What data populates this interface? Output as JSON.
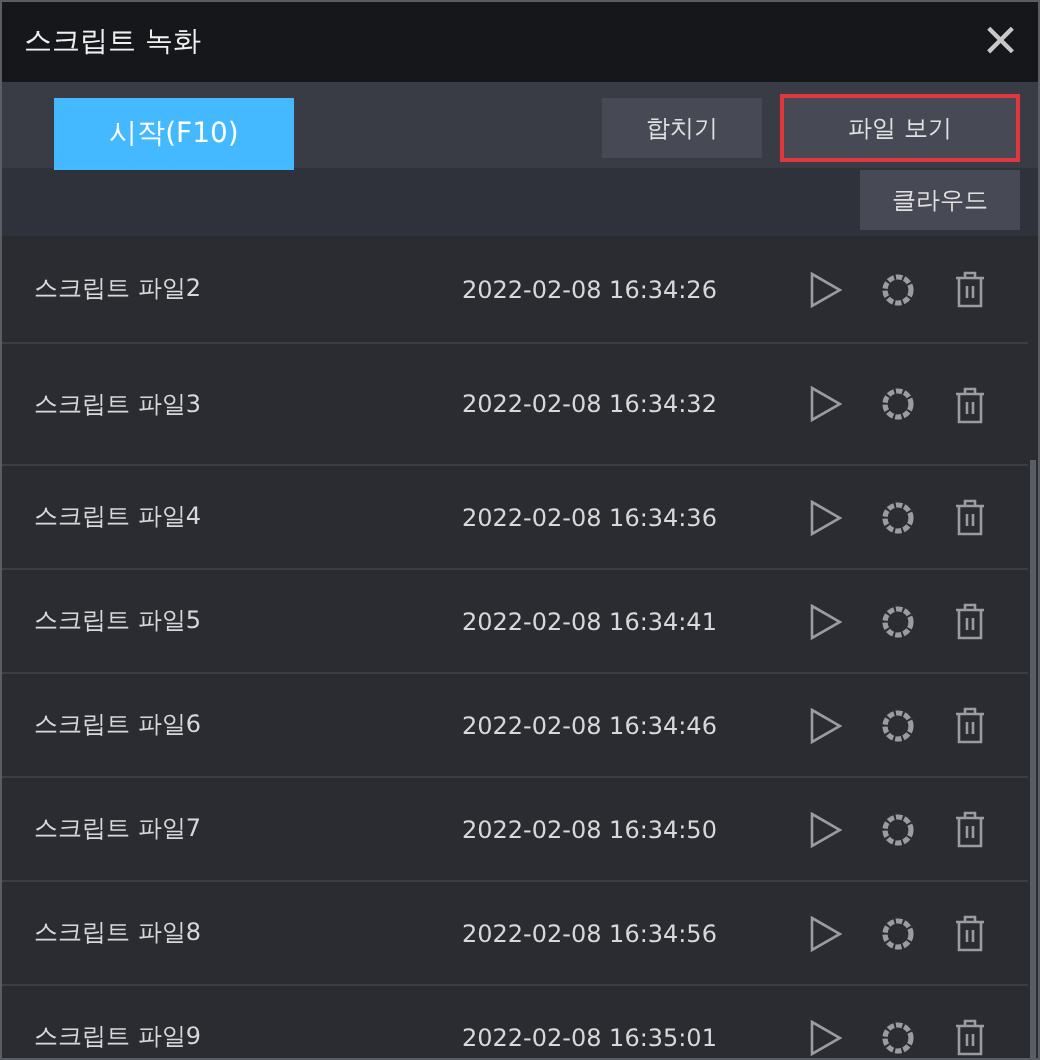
{
  "window": {
    "title": "스크립트 녹화",
    "close": "×"
  },
  "toolbar": {
    "buttons": [
      {
        "kind": "primary",
        "label": "시작(F10)",
        "selected": false
      },
      {
        "kind": "normal",
        "label": "합치기",
        "selected": false
      },
      {
        "kind": "normal",
        "label": "파일 보기",
        "selected": true
      },
      {
        "kind": "normal",
        "label": "클라우드",
        "selected": false
      }
    ]
  },
  "scripts": [
    {
      "name": "스크립트 파일2",
      "time": "2022-02-08 16:34:26"
    },
    {
      "name": "스크립트 파일3",
      "time": "2022-02-08 16:34:32"
    },
    {
      "name": "스크립트 파일4",
      "time": "2022-02-08 16:34:36"
    },
    {
      "name": "스크립트 파일5",
      "time": "2022-02-08 16:34:41"
    },
    {
      "name": "스크립트 파일6",
      "time": "2022-02-08 16:34:46"
    },
    {
      "name": "스크립트 파일7",
      "time": "2022-02-08 16:34:50"
    },
    {
      "name": "스크립트 파일8",
      "time": "2022-02-08 16:34:56"
    },
    {
      "name": "스크립트 파일9",
      "time": "2022-02-08 16:35:01"
    }
  ]
}
